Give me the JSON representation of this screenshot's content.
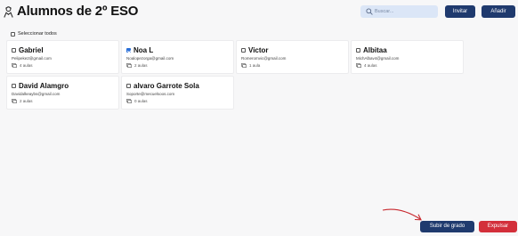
{
  "header": {
    "title": "Alumnos de 2º ESO",
    "icon": "student-icon"
  },
  "search": {
    "placeholder": "Buscar...",
    "value": "",
    "icon": "search-icon"
  },
  "actions": {
    "invite_label": "Invitar",
    "add_label": "Añadir"
  },
  "select_all": {
    "label": "Seleccionar todos",
    "checked": false
  },
  "students": [
    {
      "name": "Gabriel",
      "email": "Pelipeke2@gmail.com",
      "lessons": "4 aulas",
      "checked": false
    },
    {
      "name": "Noa L",
      "email": "Noalopezorga@gmail.com",
      "lessons": "2 aulas",
      "checked": true
    },
    {
      "name": "Victor",
      "email": "Romeromvic@gmail.com",
      "lessons": "1 aula",
      "checked": false
    },
    {
      "name": "Albitaa",
      "email": "MichAlbav4@gmail.com",
      "lessons": "4 aulas",
      "checked": false
    },
    {
      "name": "David Alamgro",
      "email": "Davidalkeaybs@gmail.com",
      "lessons": "2 aulas",
      "checked": false
    },
    {
      "name": "alvaro Garrote Sola",
      "email": "Soporte@mecuelsoos.com",
      "lessons": "0 aulas",
      "checked": false
    }
  ],
  "footer": {
    "promote_label": "Subir de grado",
    "expel_label": "Expulsar"
  },
  "colors": {
    "primary": "#1f3a6e",
    "danger": "#d32f3a",
    "search_bg": "#dbe6f7",
    "checkbox_checked": "#2a6fd8",
    "arrow": "#c8282e"
  }
}
